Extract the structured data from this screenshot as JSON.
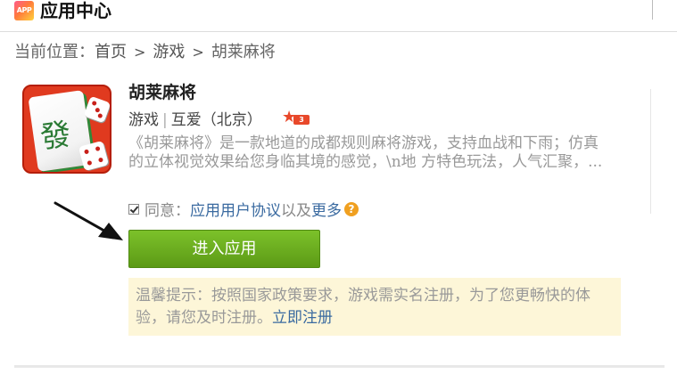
{
  "header": {
    "logo_text": "APP",
    "title": "应用中心"
  },
  "breadcrumb": {
    "prefix": "当前位置：",
    "items": [
      "首页",
      "游戏",
      "胡莱麻将"
    ],
    "separator": ">"
  },
  "app": {
    "name": "胡莱麻将",
    "category": "游戏",
    "publisher": "互爱（北京）",
    "rating_badge": "3",
    "description": "《胡莱麻将》是一款地道的成都规则麻将游戏，支持血战和下雨；仿真的立体视觉效果给您身临其境的感觉，\\n地 方特色玩法，人气汇聚，...",
    "icon_char": "發"
  },
  "agreement": {
    "prefix": "同意：",
    "link": "应用用户协议",
    "suffix": "以及",
    "more": "更多",
    "help": "?",
    "checked": true
  },
  "enter_button": {
    "label": "进入应用",
    "color": "#6aae1f"
  },
  "tip": {
    "text": "温馨提示：按照国家政策要求，游戏需实名注册，为了您更畅快的体验，请您及时注册。",
    "link": "立即注册"
  },
  "annotation": {
    "color": "#111111"
  }
}
